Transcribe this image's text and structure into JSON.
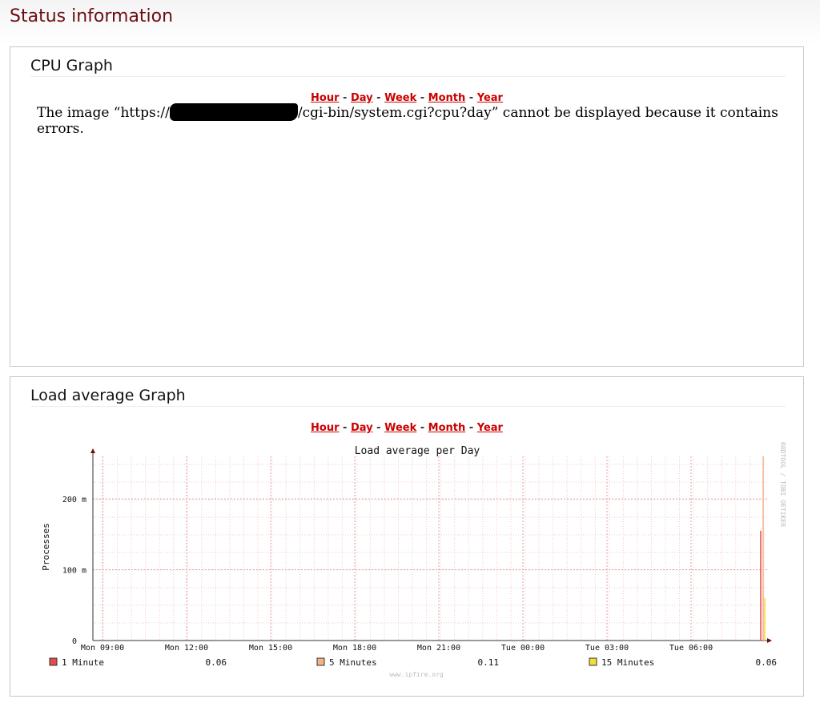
{
  "page": {
    "title": "Status information"
  },
  "range_links": {
    "hour": "Hour",
    "day": "Day",
    "week": "Week",
    "month": "Month",
    "year": "Year",
    "sep": " - "
  },
  "cpu_panel": {
    "title": "CPU Graph",
    "error_prefix": "The image “https://",
    "error_suffix": "/cgi-bin/system.cgi?cpu?day” cannot be displayed because it contains errors."
  },
  "load_panel": {
    "title": "Load average Graph",
    "graph_title": "Load average per Day",
    "side_label": "RRDTOOL / TOBI OETIKER",
    "watermark": "www.ipfire.org",
    "legend": [
      {
        "label": "1 Minute",
        "value": "0.06",
        "color": "#e84a4a"
      },
      {
        "label": "5 Minutes",
        "value": "0.11",
        "color": "#f4b48a"
      },
      {
        "label": "15 Minutes",
        "value": "0.06",
        "color": "#f1de3b"
      }
    ]
  },
  "chart_data": {
    "type": "line",
    "title": "Load average per Day",
    "ylabel": "Processes",
    "xlabel": "",
    "x_ticks": [
      "Mon 09:00",
      "Mon 12:00",
      "Mon 15:00",
      "Mon 18:00",
      "Mon 21:00",
      "Tue 00:00",
      "Tue 03:00",
      "Tue 06:00"
    ],
    "y_ticks": [
      "0",
      "100 m",
      "200 m"
    ],
    "ylim": [
      0,
      0.26
    ],
    "grid": true,
    "series": [
      {
        "name": "1 Minute",
        "color": "#e84a4a",
        "x_end": "Tue 08:20",
        "peak": 0.155
      },
      {
        "name": "5 Minutes",
        "color": "#f4b48a",
        "x_end": "Tue 08:20",
        "peak": 0.26
      },
      {
        "name": "15 Minutes",
        "color": "#f1de3b",
        "x_end": "Tue 08:20",
        "peak": 0.06
      }
    ]
  }
}
